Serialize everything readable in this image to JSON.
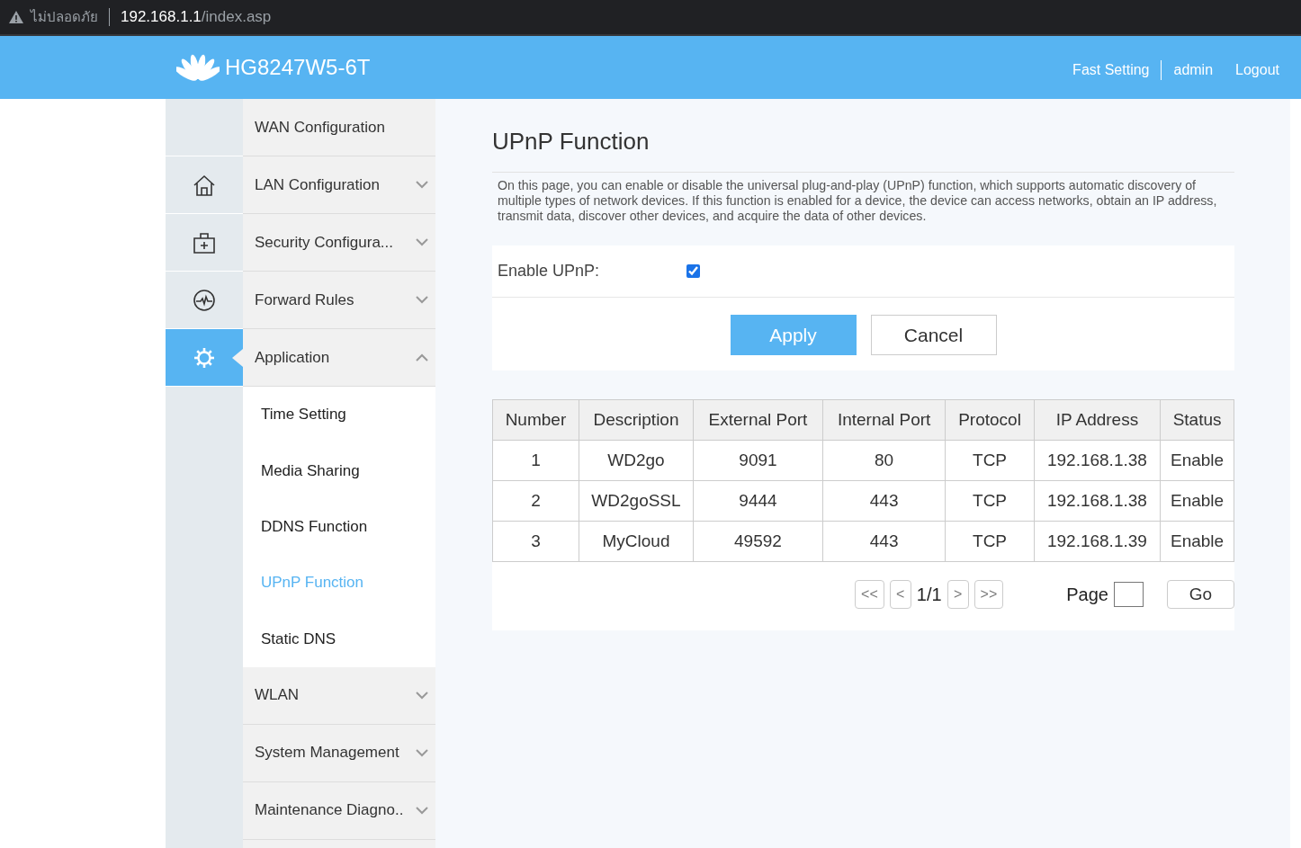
{
  "browser": {
    "security_label": "ไม่ปลอดภัย",
    "url_host": "192.168.1.1",
    "url_path": "/index.asp"
  },
  "header": {
    "product": "HG8247W5-6T",
    "links": [
      "Fast Setting",
      "admin",
      "Logout"
    ]
  },
  "icon_rail": [
    {
      "selected": false
    },
    {
      "selected": false
    },
    {
      "selected": false
    },
    {
      "selected": false
    },
    {
      "selected": true
    }
  ],
  "menu": [
    {
      "label": "WAN Configuration",
      "expandable": false
    },
    {
      "label": "LAN Configuration",
      "expandable": true,
      "expanded": false
    },
    {
      "label": "Security Configura...",
      "expandable": true,
      "expanded": false
    },
    {
      "label": "Forward Rules",
      "expandable": true,
      "expanded": false
    },
    {
      "label": "Application",
      "expandable": true,
      "expanded": true,
      "children": [
        {
          "label": "Time Setting",
          "selected": false
        },
        {
          "label": "Media Sharing",
          "selected": false
        },
        {
          "label": "DDNS Function",
          "selected": false
        },
        {
          "label": "UPnP Function",
          "selected": true
        },
        {
          "label": "Static DNS",
          "selected": false
        }
      ]
    },
    {
      "label": "WLAN",
      "expandable": true,
      "expanded": false
    },
    {
      "label": "System Management",
      "expandable": true,
      "expanded": false
    },
    {
      "label": "Maintenance Diagno..",
      "expandable": true,
      "expanded": false
    }
  ],
  "content": {
    "title": "UPnP Function",
    "description": "On this page, you can enable or disable the universal plug-and-play (UPnP) function, which supports automatic discovery of multiple types of network devices. If this function is enabled for a device, the device can access networks, obtain an IP address, transmit data, discover other devices, and acquire the data of other devices.",
    "enable_upnp": {
      "label": "Enable UPnP:",
      "checked": true
    },
    "buttons": [
      {
        "label": "Apply",
        "kind": "primary"
      },
      {
        "label": "Cancel",
        "kind": "secondary"
      }
    ],
    "table": {
      "columns": [
        "Number",
        "Description",
        "External Port",
        "Internal Port",
        "Protocol",
        "IP Address",
        "Status"
      ],
      "rows": [
        [
          "1",
          "WD2go",
          "9091",
          "80",
          "TCP",
          "192.168.1.38",
          "Enable"
        ],
        [
          "2",
          "WD2goSSL",
          "9444",
          "443",
          "TCP",
          "192.168.1.38",
          "Enable"
        ],
        [
          "3",
          "MyCloud",
          "49592",
          "443",
          "TCP",
          "192.168.1.39",
          "Enable"
        ]
      ]
    },
    "pagination": {
      "first": "<<",
      "prev": "<",
      "page_info": "1/1",
      "next": ">",
      "last": ">>",
      "page_label": "Page",
      "go": "Go"
    }
  }
}
